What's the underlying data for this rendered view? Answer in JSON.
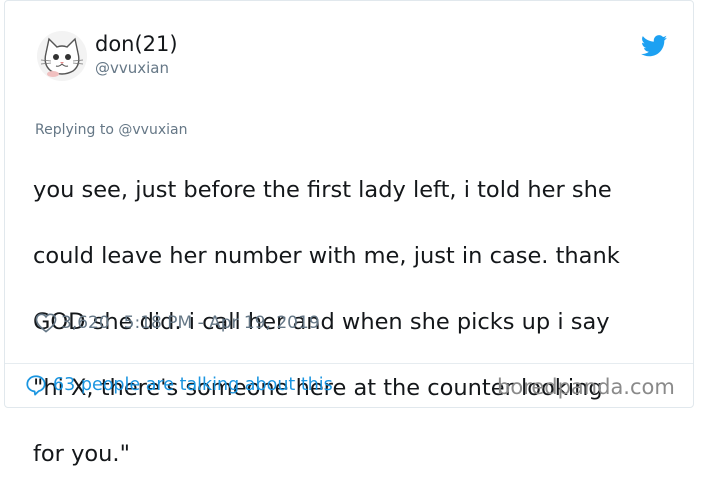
{
  "user": {
    "display_name": "don(21)",
    "handle": "@vvuxian",
    "avatar_icon": "cat-avatar-icon"
  },
  "brand": {
    "logo_icon": "twitter-bird-icon",
    "accent_color": "#1da1f2"
  },
  "tweet": {
    "replying_prefix": "Replying to",
    "replying_handle": "@vvuxian",
    "lines": [
      "you see, just before the first lady left, i told her she",
      "could leave her number with me, just in case. thank",
      "GOD she did. i call her and when she picks up i say",
      "\"hi X, there's someone here at the counter looking",
      "for you.\""
    ],
    "like_count": "3,620",
    "timestamp": "5:18 PM - Apr 19, 2019"
  },
  "footer": {
    "talking_text": "63 people are talking about this",
    "link_color": "#1b95e0",
    "watermark": "boredpanda.com"
  }
}
